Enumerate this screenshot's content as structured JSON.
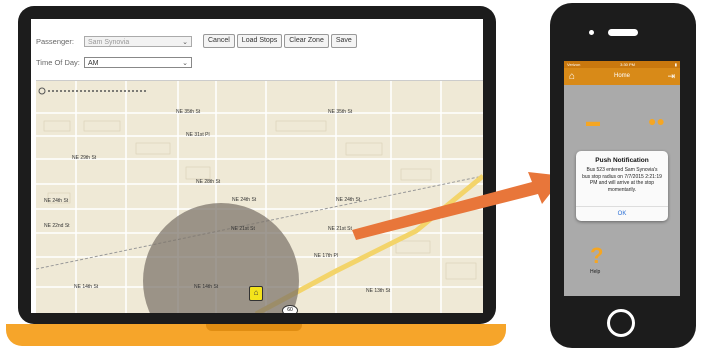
{
  "web": {
    "passenger_label": "Passenger:",
    "passenger_value": "Sam Synovia",
    "time_label": "Time Of Day:",
    "time_value": "AM",
    "buttons": [
      "Cancel",
      "Load Stops",
      "Clear Zone",
      "Save"
    ]
  },
  "map": {
    "streets": [
      "NE 35th St",
      "NE 35th St",
      "NE 31st Pl",
      "NE 29th St",
      "NE 28th St",
      "NE 24th St",
      "NE 24th St",
      "NE 24th St",
      "NE 22nd St",
      "NE 21st St",
      "NE 21st St",
      "NE 17th Pl",
      "NE 14th St",
      "NE 14th St",
      "NE 13th St"
    ],
    "highway": "60",
    "home_icon": "home-icon"
  },
  "phone": {
    "status_left": "Verizon",
    "status_time": "3:30 PM",
    "nav_title": "Home",
    "notification": {
      "title": "Push Notification",
      "body": "Bus 523 entered Sam Synovia's bus stop radius on 7/7/2015 2:21:19 PM and will arrive at the stop momentarily.",
      "ok_label": "OK"
    },
    "help_label": "Help"
  },
  "colors": {
    "accent_orange": "#f6a52a",
    "arrow": "#e8763a",
    "radius_fill": "#7a7168"
  }
}
